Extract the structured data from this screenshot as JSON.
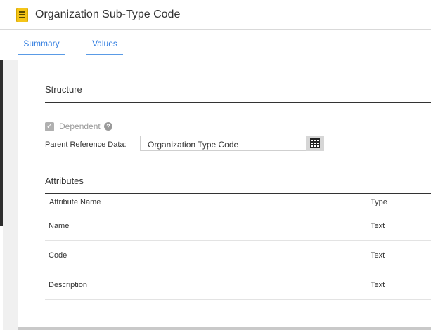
{
  "header": {
    "title": "Organization Sub-Type Code",
    "icon": "reference-data-icon"
  },
  "tabs": [
    {
      "label": "Summary"
    },
    {
      "label": "Values"
    }
  ],
  "structure": {
    "title": "Structure",
    "dependent": {
      "label": "Dependent",
      "checked": true
    },
    "parent": {
      "label": "Parent Reference Data:",
      "value": "Organization Type Code"
    }
  },
  "attributes": {
    "title": "Attributes",
    "columns": [
      "Attribute Name",
      "Type"
    ],
    "rows": [
      {
        "name": "Name",
        "type": "Text"
      },
      {
        "name": "Code",
        "type": "Text"
      },
      {
        "name": "Description",
        "type": "Text"
      }
    ]
  },
  "colors": {
    "accent": "#2f7ce0",
    "tab_underline": "#5a9be6",
    "icon_yellow": "#f5c518"
  }
}
